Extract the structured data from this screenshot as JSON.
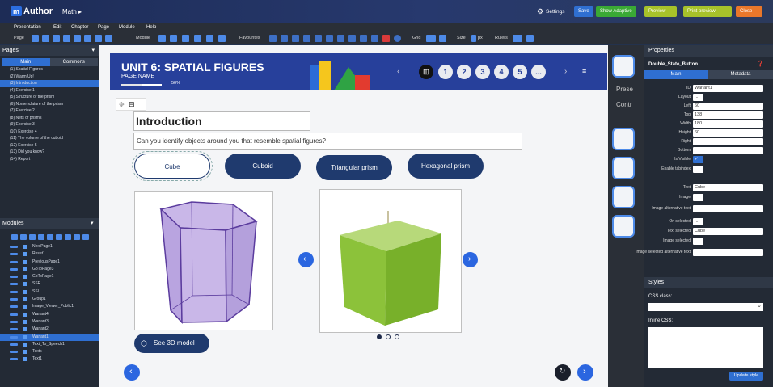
{
  "app": {
    "logo_letter": "m",
    "logo_text": "Author",
    "crumb": "Math ▸"
  },
  "top_buttons": {
    "settings": "Settings",
    "save": "Save",
    "adaptive": "Show Adaptive",
    "preview": "Preview",
    "print_preview": "Print preview",
    "close": "Close"
  },
  "menu": [
    "Presentation",
    "Edit",
    "Chapter",
    "Page",
    "Module",
    "Help"
  ],
  "toolbar": {
    "page": "Page",
    "module": "Module",
    "favourites": "Favourites",
    "grid": "Grid",
    "size": "Size",
    "size_unit": "px",
    "rulers": "Rulers"
  },
  "left": {
    "pages_title": "Pages",
    "tab_main": "Main",
    "tab_commons": "Commons",
    "pages": [
      {
        "label": "(1) Spatial Figures"
      },
      {
        "label": "(2) Warm Up!"
      },
      {
        "label": "(3) Introduction",
        "selected": true
      },
      {
        "label": "(4) Exercise 1"
      },
      {
        "label": "(5) Structure of the prism"
      },
      {
        "label": "(6) Nomenclature of the prism"
      },
      {
        "label": "(7) Exercise 2"
      },
      {
        "label": "(8) Nets of prisms"
      },
      {
        "label": "(9) Exercise 3"
      },
      {
        "label": "(10) Exercise 4"
      },
      {
        "label": "(11) The volume of the cuboid"
      },
      {
        "label": "(12) Exercise 5"
      },
      {
        "label": "(13) Did you know?"
      },
      {
        "label": "(14) Report"
      }
    ],
    "modules_title": "Modules",
    "modules": [
      {
        "label": "NextPage1"
      },
      {
        "label": "Reset1"
      },
      {
        "label": "PreviousPage1"
      },
      {
        "label": "GoToPage3"
      },
      {
        "label": "GoToPage1"
      },
      {
        "label": "SSR"
      },
      {
        "label": "SSL"
      },
      {
        "label": "Group1"
      },
      {
        "label": "Image_Viewer_Public1"
      },
      {
        "label": "Wariant4"
      },
      {
        "label": "Wariant3"
      },
      {
        "label": "Wariant2"
      },
      {
        "label": "Wariant1",
        "selected": true
      },
      {
        "label": "Text_To_Speech1"
      },
      {
        "label": "Texts"
      },
      {
        "label": "Text1"
      }
    ]
  },
  "canvas": {
    "unit_title": "UNIT 6: SPATIAL FIGURES",
    "page_name": "PAGE NAME",
    "progress_percent": 50,
    "progress_label": "50%",
    "nav_numbers": [
      "1",
      "2",
      "3",
      "4",
      "5",
      "..."
    ],
    "heading": "Introduction",
    "question": "Can you identify objects around you that resemble spatial figures?",
    "choices": [
      "Cube",
      "Cuboid",
      "Triangular prism",
      "Hexagonal prism"
    ],
    "see3d": "See 3D model"
  },
  "side_tools": {
    "pres": "Prese",
    "contr": "Contr"
  },
  "props": {
    "title": "Properties",
    "module": "Double_State_Button",
    "tab_main": "Main",
    "tab_meta": "Metadata",
    "fields": [
      {
        "label": "ID",
        "value": "Wariant1"
      },
      {
        "label": "Layout",
        "value": "..."
      },
      {
        "label": "Left",
        "value": "60"
      },
      {
        "label": "Top",
        "value": "138"
      },
      {
        "label": "Width",
        "value": "180"
      },
      {
        "label": "Height",
        "value": "60"
      },
      {
        "label": "Right",
        "value": ""
      },
      {
        "label": "Bottom",
        "value": ""
      },
      {
        "label": "Is Visible",
        "value": "✓"
      },
      {
        "label": "Enable tabindex",
        "value": ""
      },
      {
        "label": "Text",
        "value": "Cube"
      },
      {
        "label": "Image",
        "value": ""
      },
      {
        "label": "Image alternative text",
        "value": ""
      },
      {
        "label": "On selected",
        "value": "..."
      },
      {
        "label": "Text selected",
        "value": "Cube"
      },
      {
        "label": "Image selected",
        "value": ""
      },
      {
        "label": "Image selected alternative text",
        "value": ""
      }
    ],
    "styles_title": "Styles",
    "css_class": "CSS class:",
    "inline_css": "Inline CSS:",
    "update": "Update style"
  }
}
